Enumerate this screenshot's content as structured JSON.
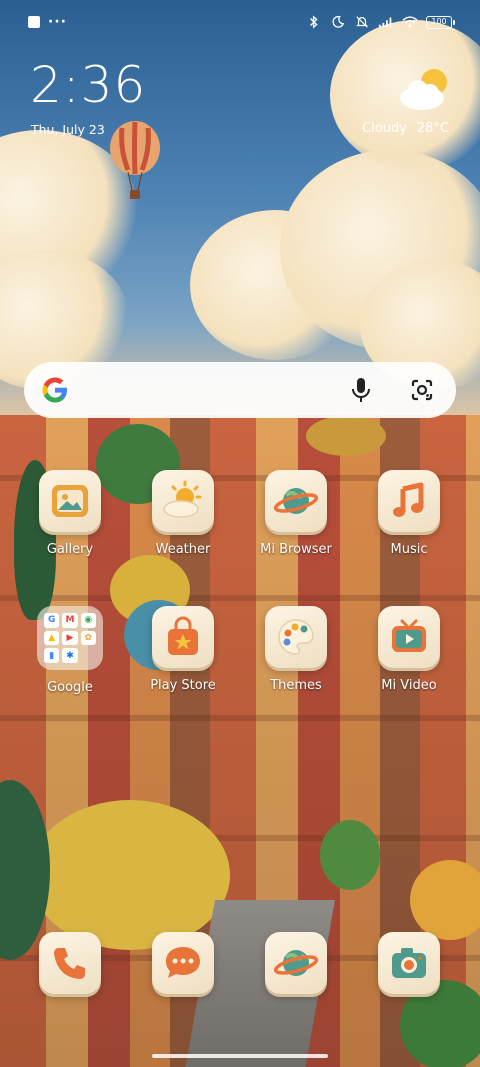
{
  "status_bar": {
    "icons_left": [
      "screen-record-icon",
      "more-dots-icon"
    ],
    "icons_right": [
      "bluetooth-icon",
      "do-not-disturb-icon",
      "silent-icon",
      "signal-icon",
      "wifi-icon"
    ],
    "battery": "100"
  },
  "clock": {
    "time": "2:36",
    "date": "Thu, July 23"
  },
  "weather": {
    "icon": "partly-cloudy-icon",
    "condition": "Cloudy",
    "temperature": "28°C"
  },
  "search_bar": {
    "logo": "google-logo-icon",
    "mic": "microphone-icon",
    "lens": "google-lens-icon"
  },
  "apps_row1": [
    {
      "label": "Gallery",
      "icon": "gallery-icon"
    },
    {
      "label": "Weather",
      "icon": "weather-app-icon"
    },
    {
      "label": "Mi Browser",
      "icon": "planet-browser-icon"
    },
    {
      "label": "Music",
      "icon": "music-note-icon"
    }
  ],
  "apps_row2": [
    {
      "label": "Google",
      "icon": "google-folder-icon"
    },
    {
      "label": "Play Store",
      "icon": "shopping-bag-icon"
    },
    {
      "label": "Themes",
      "icon": "palette-icon"
    },
    {
      "label": "Mi Video",
      "icon": "video-tv-icon"
    }
  ],
  "dock": [
    {
      "icon": "phone-icon"
    },
    {
      "icon": "messages-icon"
    },
    {
      "icon": "planet-browser-icon"
    },
    {
      "icon": "camera-icon"
    }
  ],
  "colors": {
    "tile_bg": "#fdf4e3",
    "orange": "#e8743a",
    "teal": "#3f8f8a",
    "sky": "#2b5f92"
  }
}
